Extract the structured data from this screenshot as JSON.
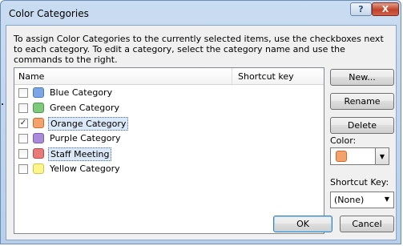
{
  "window": {
    "title": "Color Categories",
    "help_label": "?",
    "close_label": "X"
  },
  "instructions": "To assign Color Categories to the currently selected items, use the checkboxes next to each category.  To edit a category, select the category name and use the commands to the right.",
  "list": {
    "header_name": "Name",
    "header_shortcut": "Shortcut key",
    "rows": [
      {
        "label": "Blue Category",
        "checked": false,
        "color": "#7ea6e6",
        "border": "#4f78b8",
        "check_glyph": ""
      },
      {
        "label": "Green Category",
        "checked": false,
        "color": "#7fc97a",
        "border": "#4d9a49",
        "check_glyph": ""
      },
      {
        "label": "Orange Category",
        "checked": true,
        "color": "#f3a26c",
        "border": "#d4692d",
        "check_glyph": "✓"
      },
      {
        "label": "Purple Category",
        "checked": false,
        "color": "#a98bd9",
        "border": "#7d5cb3",
        "check_glyph": ""
      },
      {
        "label": "Staff Meeting",
        "checked": false,
        "color": "#e97a7a",
        "border": "#c04848",
        "check_glyph": ""
      },
      {
        "label": "Yellow Category",
        "checked": false,
        "color": "#fbf58a",
        "border": "#cfc54a",
        "check_glyph": ""
      }
    ]
  },
  "buttons": {
    "new": "New...",
    "rename": "Rename",
    "delete": "Delete",
    "ok": "OK",
    "cancel": "Cancel"
  },
  "color_label": "Color:",
  "selected_color": "#f3a26c",
  "shortcut_label": "Shortcut Key:",
  "shortcut_value": "(None)",
  "icons": {
    "dropdown": "▼",
    "check": "✓"
  }
}
